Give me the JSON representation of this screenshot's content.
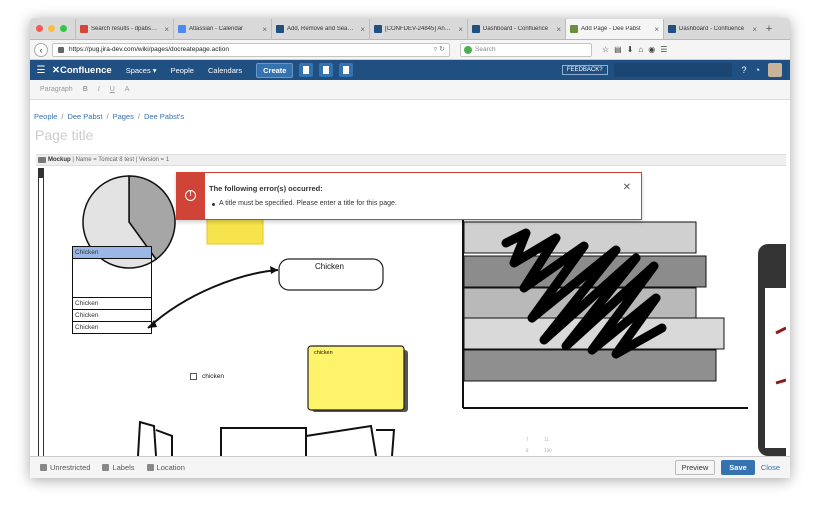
{
  "browser": {
    "tabs": [
      {
        "title": "Search results - dpabs…",
        "color": "#d44638"
      },
      {
        "title": "Atlassian - Calendar",
        "color": "#4a8af4"
      },
      {
        "title": "Add, Remove and Sea…",
        "color": "#205081"
      },
      {
        "title": "[CONFDEV-24845] An…",
        "color": "#205081"
      },
      {
        "title": "Dashboard - Confluence",
        "color": "#205081"
      },
      {
        "title": "Add Page - Dee Pabst",
        "color": "#6b8f3a"
      },
      {
        "title": "Dashboard - Confluence",
        "color": "#205081"
      }
    ],
    "url": "https://pug.jira-dev.com/wiki/pages/docreatepage.action",
    "search_placeholder": "Search"
  },
  "header": {
    "logo": "Confluence",
    "nav": [
      "Spaces ▾",
      "People",
      "Calendars"
    ],
    "create_label": "Create",
    "feedback_label": "FEEDBACK?"
  },
  "toolbar": {
    "paragraph": "Paragraph",
    "buttons": [
      "B",
      "I",
      "U",
      "A"
    ]
  },
  "breadcrumb": [
    "People",
    "Dee Pabst",
    "Pages",
    "Dee Pabst's"
  ],
  "page_title_placeholder": "Page title",
  "mockup_bar": {
    "label": "Mockup",
    "details": "| Name = Tomcat 8 test | Version = 1"
  },
  "mockup": {
    "sticky_label": "chicken",
    "bubble_label": "Chicken",
    "list_header": "Chicken",
    "list_items": [
      "Chicken",
      "Chicken",
      "Chicken"
    ],
    "checkbox_label": "chicken",
    "note_label": "chicken",
    "pie_values": [
      0.4,
      0.6
    ]
  },
  "error": {
    "title": "The following error(s) occurred:",
    "message": "A title must be specified. Please enter a title for this page."
  },
  "footer": {
    "restrict": "Unrestricted",
    "labels": "Labels",
    "location": "Location",
    "preview": "Preview",
    "save": "Save",
    "close": "Close"
  }
}
